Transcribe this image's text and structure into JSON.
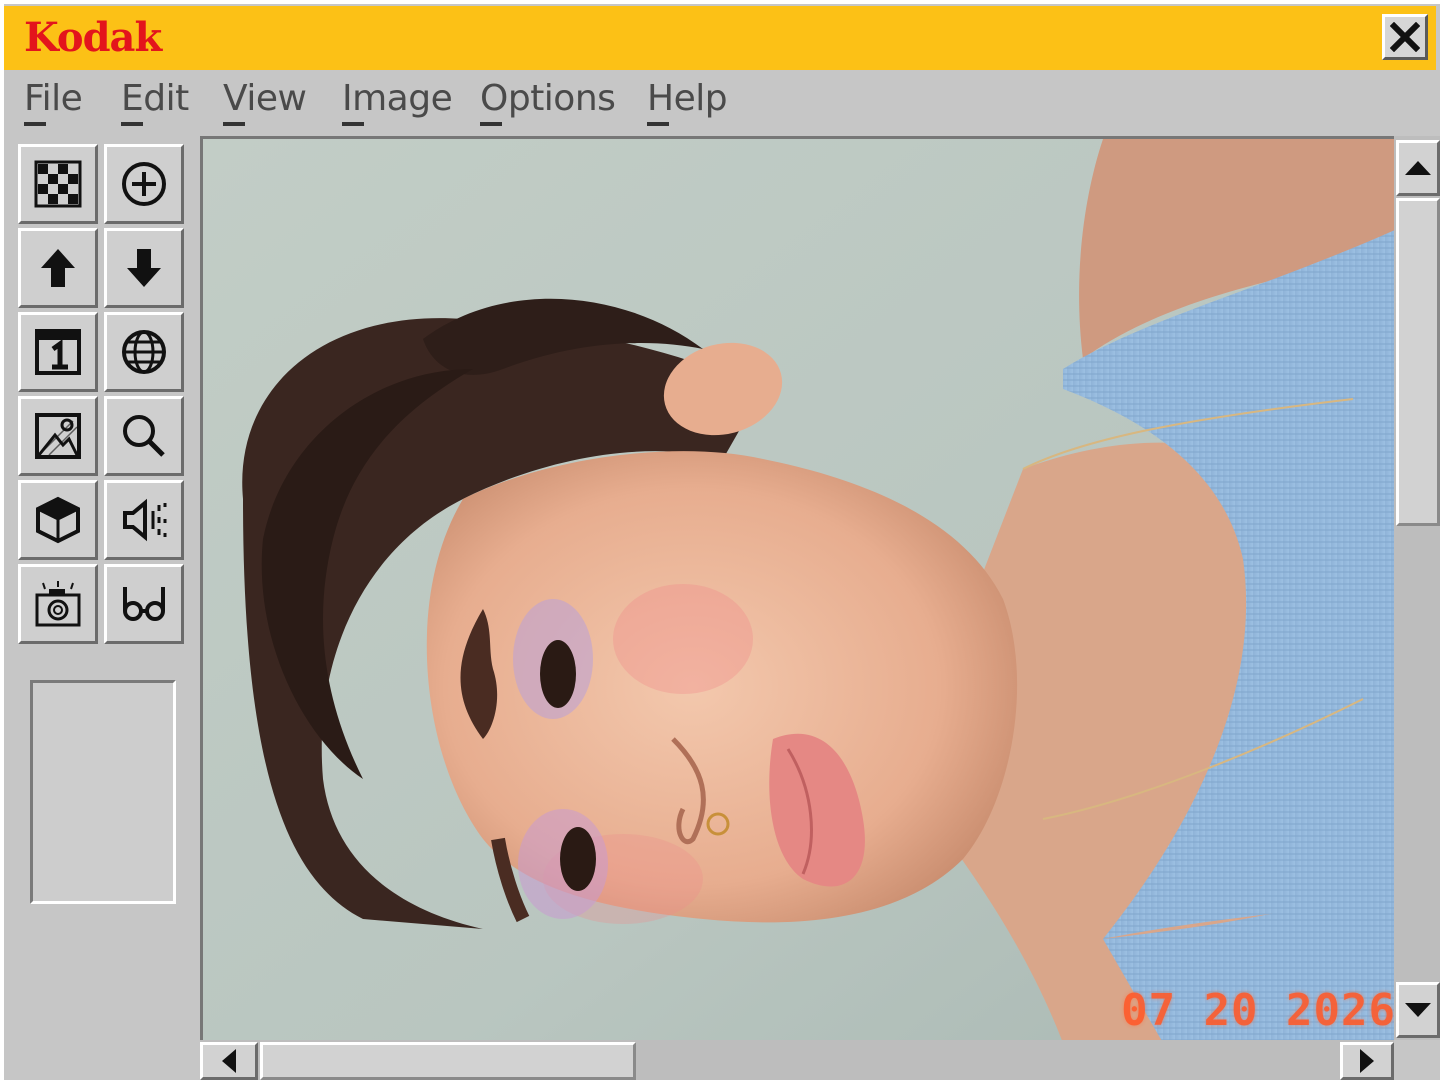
{
  "window": {
    "brand": "Kodak",
    "brand_color": "#e3141c",
    "titlebar_color": "#fcc116"
  },
  "menu": {
    "items": [
      {
        "label": "File"
      },
      {
        "label": "Edit"
      },
      {
        "label": "View"
      },
      {
        "label": "Image"
      },
      {
        "label": "Options"
      },
      {
        "label": "Help"
      }
    ]
  },
  "toolbox": {
    "tools": [
      {
        "icon": "checkerboard-icon"
      },
      {
        "icon": "zoom-in-circle-icon"
      },
      {
        "icon": "arrow-up-icon"
      },
      {
        "icon": "arrow-down-icon"
      },
      {
        "icon": "calendar-one-icon"
      },
      {
        "icon": "globe-icon"
      },
      {
        "icon": "image-icon"
      },
      {
        "icon": "magnifier-icon"
      },
      {
        "icon": "cube-icon"
      },
      {
        "icon": "speaker-icon"
      },
      {
        "icon": "camera-icon"
      },
      {
        "icon": "glasses-icon"
      }
    ]
  },
  "canvas": {
    "date_stamp": "07 20 2026",
    "date_stamp_color": "#ff5a2a"
  }
}
